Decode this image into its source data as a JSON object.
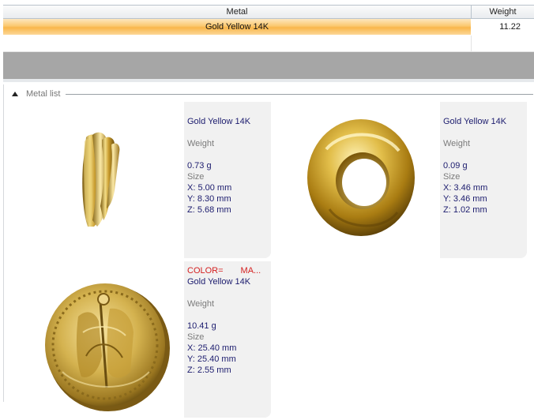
{
  "grid": {
    "columns": {
      "metal": "Metal",
      "weight": "Weight"
    },
    "rows": [
      {
        "metal": "Gold Yellow 14K",
        "weight": "11.22",
        "selected": true
      }
    ]
  },
  "metal_list": {
    "title": "Metal list",
    "items": [
      {
        "thumbnail": "bail-pendant-icon",
        "name": "Gold Yellow 14K",
        "weight_label": "Weight",
        "weight": "0.73 g",
        "size_label": "Size",
        "x": "X: 5.00 mm",
        "y": "Y: 8.30 mm",
        "z": "Z: 5.68 mm"
      },
      {
        "thumbnail": "ring-donut-icon",
        "name": "Gold Yellow 14K",
        "weight_label": "Weight",
        "weight": "0.09 g",
        "size_label": "Size",
        "x": "X: 3.46 mm",
        "y": "Y: 3.46 mm",
        "z": "Z: 1.02 mm"
      },
      {
        "thumbnail": "coin-medallion-icon",
        "color_key": "COLOR=",
        "color_val": "MA...",
        "name": "Gold Yellow 14K",
        "weight_label": "Weight",
        "weight": "10.41 g",
        "size_label": "Size",
        "x": "X: 25.40 mm",
        "y": "Y: 25.40 mm",
        "z": "Z: 2.55 mm"
      }
    ]
  },
  "colors": {
    "selected_row": "#f9b64a",
    "gray_band": "#a6a6a6",
    "info_text": "#1c1c6e",
    "color_tag": "#d41f1f",
    "gold": "#c9a227"
  }
}
